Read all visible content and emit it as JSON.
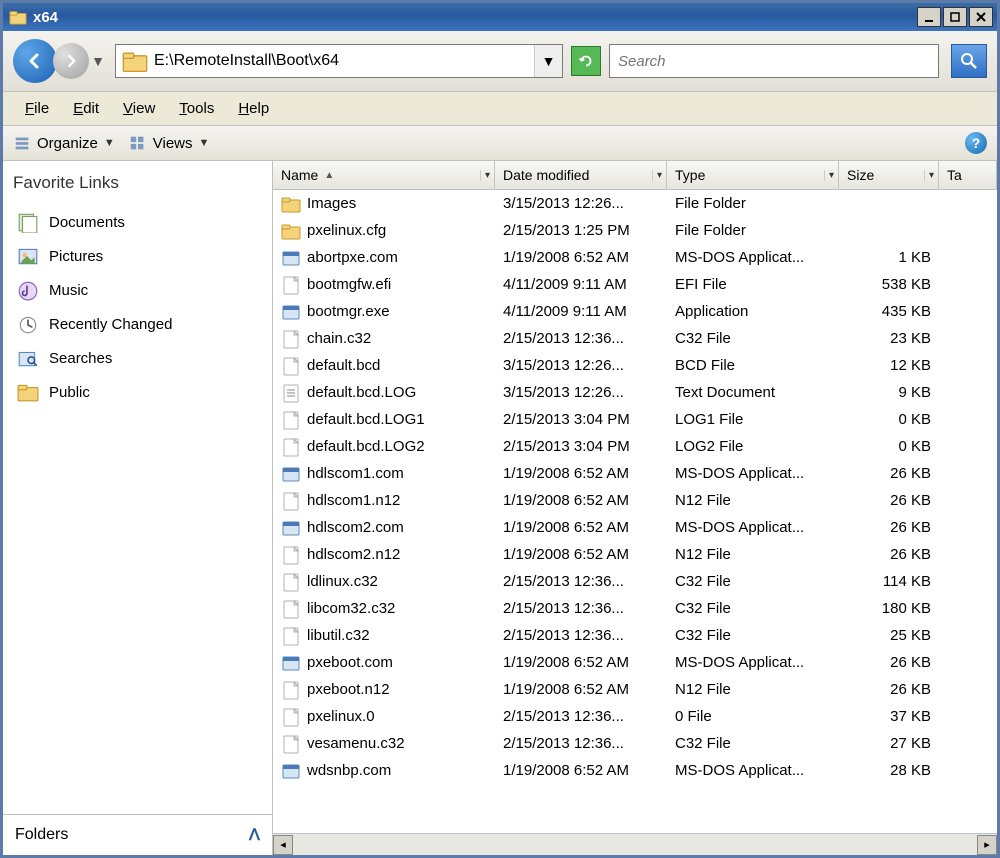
{
  "window": {
    "title": "x64"
  },
  "address": {
    "path": "E:\\RemoteInstall\\Boot\\x64"
  },
  "search": {
    "placeholder": "Search"
  },
  "menubar": {
    "file": "File",
    "edit": "Edit",
    "view": "View",
    "tools": "Tools",
    "help": "Help"
  },
  "toolbar": {
    "organize": "Organize",
    "views": "Views"
  },
  "sidebar": {
    "header": "Favorite Links",
    "items": [
      {
        "label": "Documents",
        "icon": "documents"
      },
      {
        "label": "Pictures",
        "icon": "pictures"
      },
      {
        "label": "Music",
        "icon": "music"
      },
      {
        "label": "Recently Changed",
        "icon": "recent"
      },
      {
        "label": "Searches",
        "icon": "searches"
      },
      {
        "label": "Public",
        "icon": "folder"
      }
    ],
    "folders_label": "Folders"
  },
  "columns": {
    "name": "Name",
    "date": "Date modified",
    "type": "Type",
    "size": "Size",
    "ta": "Ta"
  },
  "files": [
    {
      "name": "Images",
      "date": "3/15/2013 12:26...",
      "type": "File Folder",
      "size": "",
      "icon": "folder"
    },
    {
      "name": "pxelinux.cfg",
      "date": "2/15/2013 1:25 PM",
      "type": "File Folder",
      "size": "",
      "icon": "folder"
    },
    {
      "name": "abortpxe.com",
      "date": "1/19/2008 6:52 AM",
      "type": "MS-DOS Applicat...",
      "size": "1 KB",
      "icon": "exe"
    },
    {
      "name": "bootmgfw.efi",
      "date": "4/11/2009 9:11 AM",
      "type": "EFI File",
      "size": "538 KB",
      "icon": "file"
    },
    {
      "name": "bootmgr.exe",
      "date": "4/11/2009 9:11 AM",
      "type": "Application",
      "size": "435 KB",
      "icon": "exe"
    },
    {
      "name": "chain.c32",
      "date": "2/15/2013 12:36...",
      "type": "C32 File",
      "size": "23 KB",
      "icon": "file"
    },
    {
      "name": "default.bcd",
      "date": "3/15/2013 12:26...",
      "type": "BCD File",
      "size": "12 KB",
      "icon": "file"
    },
    {
      "name": "default.bcd.LOG",
      "date": "3/15/2013 12:26...",
      "type": "Text Document",
      "size": "9 KB",
      "icon": "txt"
    },
    {
      "name": "default.bcd.LOG1",
      "date": "2/15/2013 3:04 PM",
      "type": "LOG1 File",
      "size": "0 KB",
      "icon": "file"
    },
    {
      "name": "default.bcd.LOG2",
      "date": "2/15/2013 3:04 PM",
      "type": "LOG2 File",
      "size": "0 KB",
      "icon": "file"
    },
    {
      "name": "hdlscom1.com",
      "date": "1/19/2008 6:52 AM",
      "type": "MS-DOS Applicat...",
      "size": "26 KB",
      "icon": "exe"
    },
    {
      "name": "hdlscom1.n12",
      "date": "1/19/2008 6:52 AM",
      "type": "N12 File",
      "size": "26 KB",
      "icon": "file"
    },
    {
      "name": "hdlscom2.com",
      "date": "1/19/2008 6:52 AM",
      "type": "MS-DOS Applicat...",
      "size": "26 KB",
      "icon": "exe"
    },
    {
      "name": "hdlscom2.n12",
      "date": "1/19/2008 6:52 AM",
      "type": "N12 File",
      "size": "26 KB",
      "icon": "file"
    },
    {
      "name": "ldlinux.c32",
      "date": "2/15/2013 12:36...",
      "type": "C32 File",
      "size": "114 KB",
      "icon": "file"
    },
    {
      "name": "libcom32.c32",
      "date": "2/15/2013 12:36...",
      "type": "C32 File",
      "size": "180 KB",
      "icon": "file"
    },
    {
      "name": "libutil.c32",
      "date": "2/15/2013 12:36...",
      "type": "C32 File",
      "size": "25 KB",
      "icon": "file"
    },
    {
      "name": "pxeboot.com",
      "date": "1/19/2008 6:52 AM",
      "type": "MS-DOS Applicat...",
      "size": "26 KB",
      "icon": "exe"
    },
    {
      "name": "pxeboot.n12",
      "date": "1/19/2008 6:52 AM",
      "type": "N12 File",
      "size": "26 KB",
      "icon": "file"
    },
    {
      "name": "pxelinux.0",
      "date": "2/15/2013 12:36...",
      "type": "0 File",
      "size": "37 KB",
      "icon": "file"
    },
    {
      "name": "vesamenu.c32",
      "date": "2/15/2013 12:36...",
      "type": "C32 File",
      "size": "27 KB",
      "icon": "file"
    },
    {
      "name": "wdsnbp.com",
      "date": "1/19/2008 6:52 AM",
      "type": "MS-DOS Applicat...",
      "size": "28 KB",
      "icon": "exe"
    }
  ]
}
